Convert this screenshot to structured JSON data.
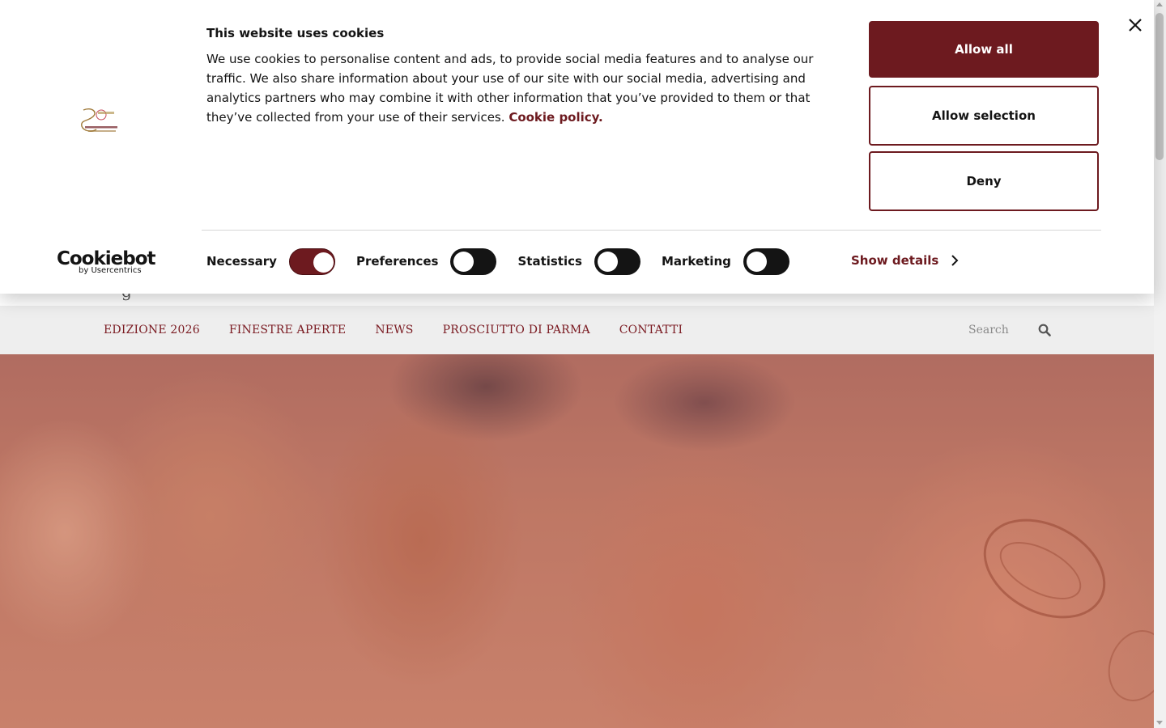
{
  "cookie_banner": {
    "title": "This website uses cookies",
    "body": "We use cookies to personalise content and ads, to provide social media features and to analyse our traffic. We also share information about your use of our site with our social media, advertising and analytics partners who may combine it with other information that you’ve provided to them or that they’ve collected from your use of their services.",
    "policy_link": "Cookie policy.",
    "buttons": {
      "allow_all": "Allow all",
      "allow_selection": "Allow selection",
      "deny": "Deny"
    },
    "toggles": [
      {
        "label": "Necessary",
        "enabled": true
      },
      {
        "label": "Preferences",
        "enabled": false
      },
      {
        "label": "Statistics",
        "enabled": false
      },
      {
        "label": "Marketing",
        "enabled": false
      }
    ],
    "show_details": "Show details",
    "brand": {
      "name": "Cookiebot",
      "sub": "by Usercentrics"
    },
    "close_icon": "close-icon",
    "accent_color": "#6d1a1f"
  },
  "site": {
    "header_fragment": "g",
    "nav": {
      "items": [
        "EDIZIONE 2026",
        "FINESTRE APERTE",
        "NEWS",
        "PROSCIUTTO DI PARMA",
        "CONTATTI"
      ],
      "search_placeholder": "Search",
      "search_icon": "search-icon"
    },
    "link_color": "#7a1a21"
  }
}
